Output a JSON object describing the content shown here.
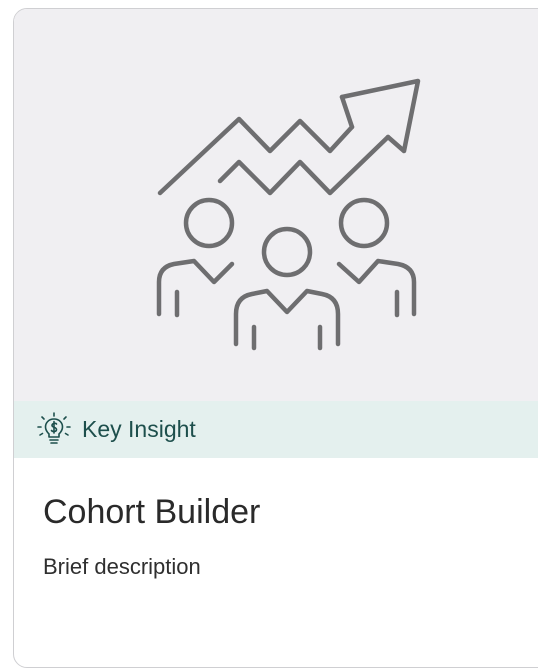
{
  "card": {
    "insight_label": "Key Insight",
    "title": "Cohort Builder",
    "description": "Brief description"
  },
  "icons": {
    "hero": "group-growth-icon",
    "insight": "lightbulb-icon"
  },
  "colors": {
    "hero_background": "#f0eff2",
    "insight_background": "#e4f0ee",
    "insight_text": "#1d4f4c",
    "icon_stroke": "#6e6e70"
  }
}
